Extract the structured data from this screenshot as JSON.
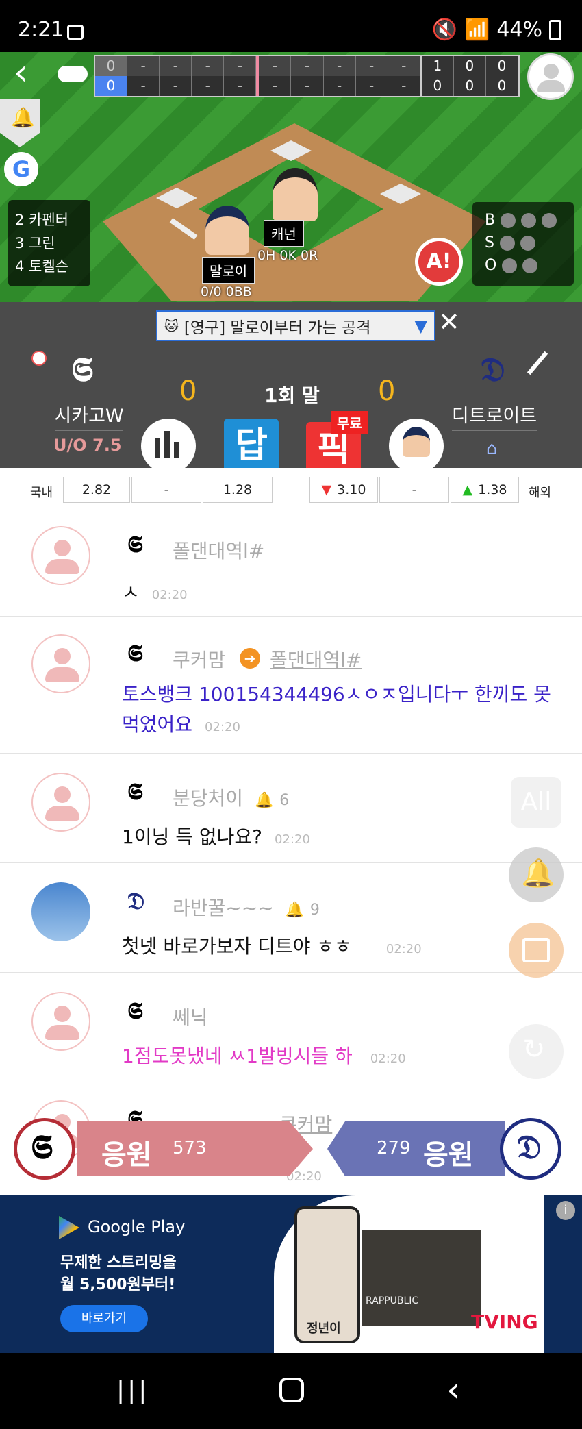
{
  "status_bar": {
    "time": "2:21",
    "battery": "44%"
  },
  "scoreboard": {
    "top_first": "0",
    "bottom_first": "0",
    "top_innings": [
      "-",
      "-",
      "-",
      "-",
      "-",
      "-",
      "-",
      "-",
      "-"
    ],
    "bottom_innings": [
      "-",
      "-",
      "-",
      "-",
      "-",
      "-",
      "-",
      "-",
      "-"
    ],
    "top_rhe": [
      "1",
      "0",
      "0"
    ],
    "bottom_rhe": [
      "0",
      "0",
      "0"
    ]
  },
  "lineup": [
    "2 카펜터",
    "3 그린",
    "4 토켈슨"
  ],
  "count": {
    "labels": [
      "B",
      "S",
      "O"
    ]
  },
  "pitcher": {
    "name": "캐넌",
    "stat": "0H 0K 0R"
  },
  "batter": {
    "name": "말로이",
    "stat": "0/0 0BB"
  },
  "alert_label": "A!",
  "notice": {
    "text": "[영구] 말로이부터 가는 공격"
  },
  "game": {
    "away_team": "시카고W",
    "away_ou": "U/O 7.5",
    "away_score": "0",
    "inning": "1회 말",
    "home_score": "0",
    "home_team": "디트로이트",
    "tile_answer": "답",
    "tile_pick": "픽",
    "free_badge": "무료"
  },
  "odds": {
    "domestic_label": "국내",
    "domestic": [
      "2.82",
      "-",
      "1.28"
    ],
    "overseas": [
      "3.10",
      "-",
      "1.38"
    ],
    "overseas_label": "해외"
  },
  "chat": [
    {
      "nick": "폴댄대역l#",
      "text": "ㅅ",
      "time": "02:20"
    },
    {
      "nick": "쿠커맘",
      "reply_to": "폴댄대역l#",
      "text": "토스뱅크 100154344496ㅅㅇㅈ입니다ㅜ 한끼도 못먹었어요",
      "time": "02:20"
    },
    {
      "nick": "분당처이",
      "likes": "6",
      "text": "1이닝 득 없나요?",
      "time": "02:20"
    },
    {
      "nick": "라반꿀~~~",
      "likes": "9",
      "text": "첫넷 바로가보자 디트야 ㅎㅎ",
      "time": "02:20"
    },
    {
      "nick": "쎄닉",
      "text": "1점도못냈네 ㅆ1발빙시들 하",
      "time": "02:20"
    },
    {
      "nick": "쿠커맘",
      "text": "",
      "time": "02:20"
    }
  ],
  "side": {
    "all": "All"
  },
  "cheer": {
    "label": "응원",
    "away_count": "573",
    "home_count": "279"
  },
  "ad": {
    "brand": "Google Play",
    "line1": "무제한 스트리밍을",
    "line2": "월 5,500원부터!",
    "button": "바로가기",
    "poster_caption": "정년이",
    "poster2_caption": "RAPPUBLIC",
    "logo": "TVING"
  }
}
